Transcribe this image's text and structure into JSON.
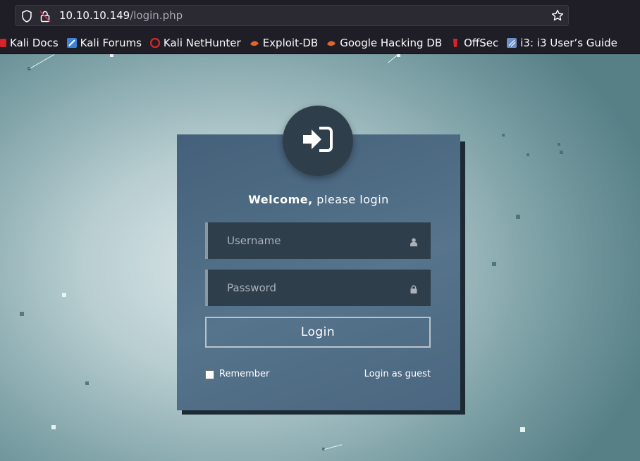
{
  "browser": {
    "url_host": "10.10.10.149",
    "url_path": "/login.php",
    "bookmarks": [
      {
        "label": "Kali Docs",
        "icon": "kali-docs-icon",
        "color": "#d9232b"
      },
      {
        "label": "Kali Forums",
        "icon": "kali-forums-icon",
        "color": "#3d82d8"
      },
      {
        "label": "Kali NetHunter",
        "icon": "nethunter-icon",
        "color": "#c9252b"
      },
      {
        "label": "Exploit-DB",
        "icon": "exploit-db-icon",
        "color": "#e0662a"
      },
      {
        "label": "Google Hacking DB",
        "icon": "ghdb-icon",
        "color": "#e0662a"
      },
      {
        "label": "OffSec",
        "icon": "offsec-icon",
        "color": "#d9232b"
      },
      {
        "label": "i3: i3 User’s Guide",
        "icon": "i3-icon",
        "color": "#6b8fc9"
      }
    ]
  },
  "login": {
    "welcome_bold": "Welcome,",
    "welcome_rest": " please login",
    "username_placeholder": "Username",
    "password_placeholder": "Password",
    "login_button": "Login",
    "remember_label": "Remember",
    "guest_link": "Login as guest",
    "badge_icon": "sign-in-icon"
  },
  "colors": {
    "card": "#4e6b83",
    "field": "#2f3e4b",
    "accent_border": "#8c98a3"
  }
}
